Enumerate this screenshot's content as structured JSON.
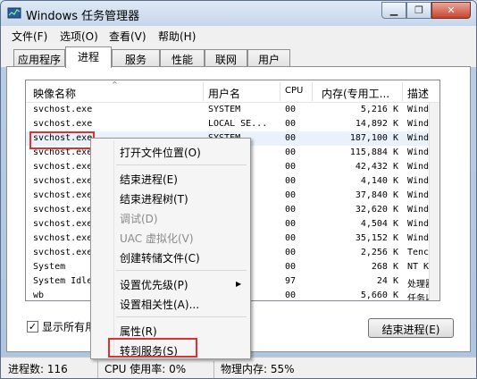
{
  "titlebar": {
    "title": "Windows 任务管理器",
    "minimize": "▁",
    "restore": "❐",
    "close": "✕"
  },
  "menubar": [
    "文件(F)",
    "选项(O)",
    "查看(V)",
    "帮助(H)"
  ],
  "tabs": [
    "应用程序",
    "进程",
    "服务",
    "性能",
    "联网",
    "用户"
  ],
  "active_tab": "进程",
  "table": {
    "headers": [
      "映像名称",
      "用户名",
      "CPU",
      "内存(专用工...",
      "描述"
    ],
    "sorted_column": "映像名称",
    "rows": [
      [
        "svchost.exe",
        "SYSTEM",
        "00",
        "5,216 K",
        "Windo"
      ],
      [
        "svchost.exe",
        "LOCAL SE...",
        "00",
        "14,892 K",
        "Windo"
      ],
      [
        "svchost.exe",
        "SYSTEM",
        "00",
        "187,100 K",
        "Windo"
      ],
      [
        "svchost.exe",
        "",
        "00",
        "115,884 K",
        "Windo"
      ],
      [
        "svchost.exe",
        "",
        "00",
        "42,432 K",
        "Windo"
      ],
      [
        "svchost.exe",
        "...",
        "00",
        "4,140 K",
        "Windo"
      ],
      [
        "svchost.exe",
        "...",
        "00",
        "37,840 K",
        "Windo"
      ],
      [
        "svchost.exe",
        "...",
        "00",
        "32,620 K",
        "Windo"
      ],
      [
        "svchost.exe",
        "...",
        "00",
        "4,504 K",
        "Windo"
      ],
      [
        "svchost.exe",
        "",
        "00",
        "35,152 K",
        "Windo"
      ],
      [
        "svchost.exe",
        "",
        "00",
        "2,256 K",
        "Tencen"
      ],
      [
        "System",
        "",
        "00",
        "268 K",
        "NT Ker"
      ],
      [
        "System Idle",
        "",
        "97",
        "24 K",
        "处理器"
      ],
      [
        "wb",
        "",
        "00",
        "5,660 K",
        "任务以"
      ]
    ]
  },
  "show_all_users": {
    "label": "显示所有用户",
    "checked": true,
    "mark": "✓"
  },
  "end_process_button": "结束进程(E)",
  "statusbar": {
    "processes": "进程数: 116",
    "cpu": "CPU 使用率: 0%",
    "memory": "物理内存: 55%"
  },
  "context_menu": {
    "items": [
      {
        "label": "打开文件位置(O)",
        "disabled": false
      },
      {
        "label": "结束进程(E)",
        "disabled": false
      },
      {
        "label": "结束进程树(T)",
        "disabled": false
      },
      {
        "label": "调试(D)",
        "disabled": true
      },
      {
        "label": "UAC 虚拟化(V)",
        "disabled": true
      },
      {
        "label": "创建转储文件(C)",
        "disabled": false
      },
      {
        "label": "设置优先级(P)",
        "disabled": false,
        "submenu_arrow": "▶"
      },
      {
        "label": "设置相关性(A)...",
        "disabled": false
      },
      {
        "label": "属性(R)",
        "disabled": false
      },
      {
        "label": "转到服务(S)",
        "disabled": false
      }
    ]
  },
  "colors": {
    "highlight_box": "#e03030",
    "selected_row": "#e9f1fb"
  },
  "icons": {
    "sort": "sort-up-icon",
    "app": "task-manager-icon",
    "checkbox": "checkmark-icon"
  },
  "sort_arrow": "^"
}
